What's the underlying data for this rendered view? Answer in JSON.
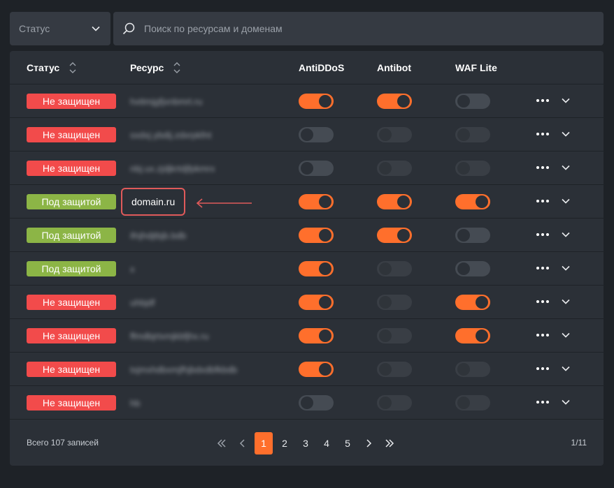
{
  "filter": {
    "status_label": "Статус"
  },
  "search": {
    "placeholder": "Поиск по ресурсам и доменам"
  },
  "columns": {
    "status": "Статус",
    "resource": "Ресурс",
    "antiddos": "AntiDDoS",
    "antibot": "Antibot",
    "waf": "WAF Lite"
  },
  "status_labels": {
    "unprotected": "Не защищен",
    "protected": "Под защитой"
  },
  "rows": [
    {
      "status": "Не защищен",
      "status_type": "unprotected",
      "resource": "hxttmjgfjxnbmrt.ru",
      "blurred": true,
      "antiddos": "on",
      "antibot": "on",
      "waf": "off"
    },
    {
      "status": "Не защищен",
      "status_type": "unprotected",
      "resource": "sxdxj.ybdij.zdxrpkfnt",
      "blurred": true,
      "antiddos": "off",
      "antibot": "disabled",
      "waf": "disabled"
    },
    {
      "status": "Не защищен",
      "status_type": "unprotected",
      "resource": "nbj.ux.zjdjkrtdjfpkmrx",
      "blurred": true,
      "antiddos": "off",
      "antibot": "disabled",
      "waf": "disabled"
    },
    {
      "status": "Под защитой",
      "status_type": "protected",
      "resource": "domain.ru",
      "blurred": false,
      "antiddos": "on",
      "antibot": "on",
      "waf": "on"
    },
    {
      "status": "Под защитой",
      "status_type": "protected",
      "resource": "ifnjhdjtbjb.bdb",
      "blurred": true,
      "antiddos": "on",
      "antibot": "on",
      "waf": "off"
    },
    {
      "status": "Под защитой",
      "status_type": "protected",
      "resource": "x",
      "blurred": true,
      "antiddos": "on",
      "antibot": "disabled",
      "waf": "off"
    },
    {
      "status": "Не защищен",
      "status_type": "unprotected",
      "resource": "uhbjdf",
      "blurred": true,
      "antiddos": "on",
      "antibot": "disabled",
      "waf": "on"
    },
    {
      "status": "Не защищен",
      "status_type": "unprotected",
      "resource": "ffmdbjrtxmjkbfjhx.ru",
      "blurred": true,
      "antiddos": "on",
      "antibot": "disabled",
      "waf": "on"
    },
    {
      "status": "Не защищен",
      "status_type": "unprotected",
      "resource": "txjmxhdbxmjfhjbdxdbfkbdb",
      "blurred": true,
      "antiddos": "on",
      "antibot": "disabled",
      "waf": "disabled"
    },
    {
      "status": "Не защищен",
      "status_type": "unprotected",
      "resource": "hb",
      "blurred": true,
      "antiddos": "off",
      "antibot": "disabled",
      "waf": "disabled"
    }
  ],
  "footer": {
    "total": "Всего 107 записей",
    "page_info": "1/11"
  },
  "pagination": {
    "pages": [
      "1",
      "2",
      "3",
      "4",
      "5"
    ],
    "current": "1"
  },
  "colors": {
    "accent": "#ff6f2c",
    "danger": "#f24b4b",
    "success": "#8cb546",
    "annotation": "#e05a5a"
  }
}
